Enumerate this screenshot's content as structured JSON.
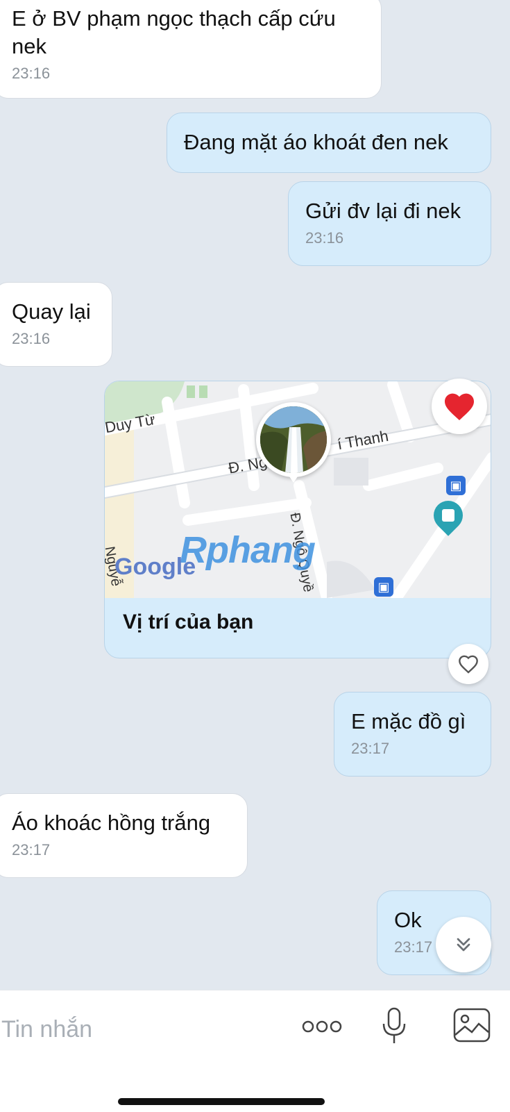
{
  "messages": [
    {
      "side": "in",
      "text": "E ở BV phạm ngọc thạch cấp cứu\nnek",
      "time": "23:16"
    },
    {
      "side": "out",
      "text": "Đang mặt áo khoát đen nek",
      "time": ""
    },
    {
      "side": "out",
      "text": "Gửi đv lại đi nek",
      "time": "23:16"
    },
    {
      "side": "in",
      "text": "Quay lại",
      "time": "23:16"
    },
    {
      "side": "out",
      "text": "E mặc đồ gì",
      "time": "23:17"
    },
    {
      "side": "in",
      "text": "Áo khoác hồng trắng",
      "time": "23:17"
    },
    {
      "side": "out",
      "text": "Ok",
      "time": "23:17"
    }
  ],
  "location_card": {
    "caption": "Vị trí của bạn",
    "map_labels": {
      "street_1": "Duy Từ",
      "street_2_left": "Đ. Ng",
      "street_2_right": "í Thanh",
      "street_3": "Đ. Ngô Quyề",
      "street_4": "Nguyễ",
      "google": "Google",
      "watermark": "Rphang"
    }
  },
  "composer": {
    "placeholder": "Tin nhắn"
  },
  "icons": {
    "reaction_heart_filled": "heart-filled-icon",
    "reaction_heart_outline": "heart-outline-icon",
    "scroll_down": "chevron-double-down-icon",
    "more": "more-dots-icon",
    "mic": "microphone-icon",
    "gallery": "image-icon"
  },
  "colors": {
    "incoming_bubble": "#ffffff",
    "outgoing_bubble": "#d6ecfb",
    "background": "#e2e8ef",
    "heart": "#e5252f"
  }
}
